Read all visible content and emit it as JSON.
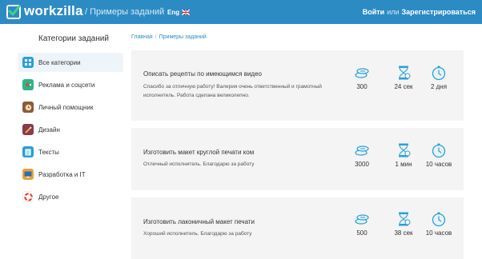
{
  "header": {
    "brand": "workzilla",
    "subtitle": "/ Примеры заданий",
    "language": "Eng",
    "login": "Войти",
    "or": "или",
    "register": "Зарегистрироваться",
    "color": "#2d8bc4"
  },
  "sidebar": {
    "title": "Категории заданий",
    "items": [
      {
        "label": "Все категории",
        "icon": "grid-icon",
        "color": "#2b9fd8"
      },
      {
        "label": "Реклама и соцсети",
        "icon": "megaphone-icon",
        "color": "#2bb58a"
      },
      {
        "label": "Личный помощник",
        "icon": "clock-icon",
        "color": "#8a5a3a"
      },
      {
        "label": "Дизайн",
        "icon": "brush-icon",
        "color": "#8a3a4a"
      },
      {
        "label": "Тексты",
        "icon": "document-icon",
        "color": "#2b9fd8"
      },
      {
        "label": "Разработка и IT",
        "icon": "code-icon",
        "color": "#e8a23a"
      },
      {
        "label": "Другое",
        "icon": "lifebuoy-icon",
        "color": "#d84a3a"
      }
    ]
  },
  "breadcrumb": {
    "home": "Главная",
    "separator": "/",
    "current": "Примеры заданий"
  },
  "tasks": [
    {
      "title": "Описать рецепты по имеющимся видео",
      "description": "Спасибо за отличную работу! Валерия очень ответственный и грамотный исполнитель. Работа сделана великолепно.",
      "price": "300",
      "response_time": "24 сек",
      "duration": "2 дня"
    },
    {
      "title": "Изготовить макет круглой печати ком",
      "description": "Отличный исполнитель. Благодарю за работу",
      "price": "3000",
      "response_time": "1 мин",
      "duration": "10 часов"
    },
    {
      "title": "Изготовить лаконичный макет печати",
      "description": "Хороший исполнитель. Благодарю за работу",
      "price": "500",
      "response_time": "38 сек",
      "duration": "10 часов"
    }
  ]
}
